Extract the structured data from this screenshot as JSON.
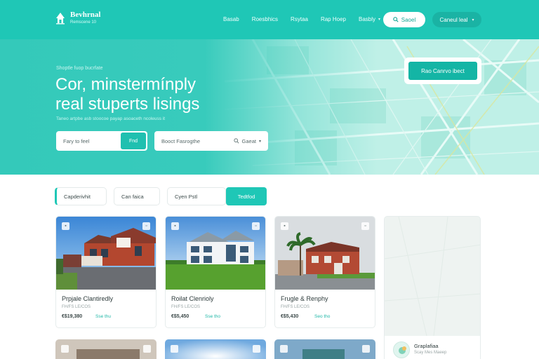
{
  "header": {
    "logo_title": "Bevhrnal",
    "logo_subtitle": "Remscene 10",
    "nav": [
      {
        "label": "Basab",
        "caret": false
      },
      {
        "label": "Roesbhics",
        "caret": false
      },
      {
        "label": "Rsytaa",
        "caret": false
      },
      {
        "label": "Rap Hoep",
        "caret": false
      },
      {
        "label": "Basbly",
        "caret": true
      }
    ],
    "search_pill_label": "Saoel",
    "account_label": "Caneul leal",
    "icons": {
      "logo": "house-logo-icon",
      "search": "search-icon",
      "caret": "chevron-down-icon"
    }
  },
  "hero": {
    "eyebrow": "Shoptle fuop bucrfate",
    "title_line1": "Cor, minstermínply",
    "title_line2": "real stuperts lisings",
    "description": "Taneo artpbe asb stoocoe payap asoaceth ncoleuss it",
    "search_primary_placeholder": "Fary to feel",
    "search_primary_button": "Fnd",
    "search_secondary_placeholder": "Booct Fasrogthe",
    "search_secondary_right": "Gaeat",
    "cta_label": "Rao Canrvo ibect"
  },
  "filters": {
    "items": [
      "Capderivhit",
      "Can faica",
      "Cyen Pstl"
    ],
    "button_label": "Tedtfod"
  },
  "listings": [
    {
      "title": "Prpjale Clantiredly",
      "subtitle": "FH/FS LE/COS",
      "price": "€$19,380",
      "tag": "Sse thu",
      "image": "brick-house-photo"
    },
    {
      "title": "Roilat Clenrioly",
      "subtitle": "FH/FS LE/COS",
      "price": "€$5,450",
      "tag": "Sse tho",
      "image": "white-villa-photo"
    },
    {
      "title": "Frugle & Renphy",
      "subtitle": "FH/FS LE/COS",
      "price": "€$5,430",
      "tag": "Seo tho",
      "image": "palm-house-photo"
    }
  ],
  "map_panel": {
    "title": "Graplafiaa",
    "subtitle": "Scay Mes Maeep"
  },
  "colors": {
    "brand": "#1fc7b6",
    "brand_dark": "#14b5a5",
    "map_light": "#bff0e7"
  }
}
